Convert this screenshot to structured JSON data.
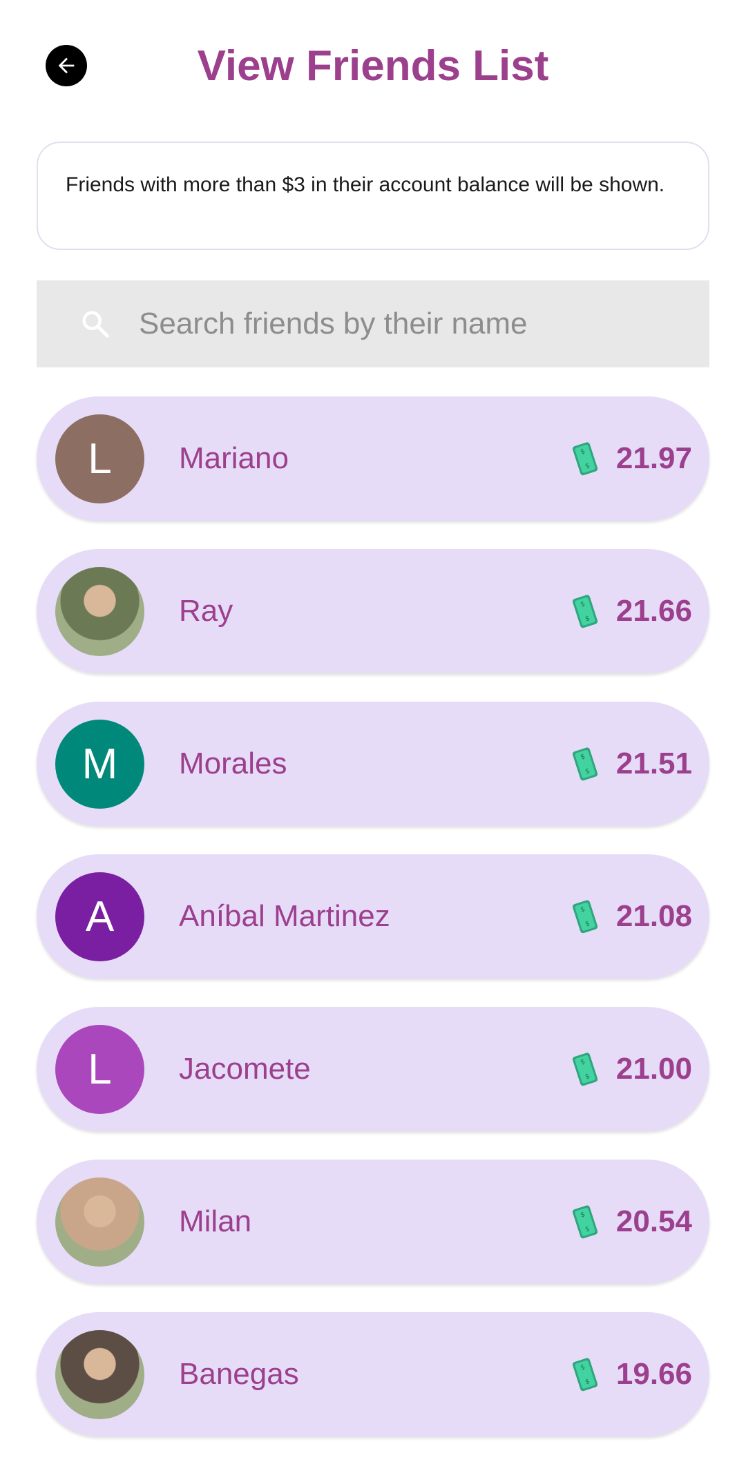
{
  "header": {
    "back_icon": "arrow-left-icon",
    "title": "View Friends List"
  },
  "notice": {
    "text": "Friends with more than $3 in their account balance will be shown."
  },
  "search": {
    "icon": "search-icon",
    "placeholder": "Search friends by their name",
    "value": ""
  },
  "colors": {
    "accent": "#9c3f8d",
    "row_background": "#e6dcf8",
    "search_background": "#e8e8e8",
    "money_green": "#3ec79a"
  },
  "friends": [
    {
      "name": "Mariano",
      "initial": "L",
      "avatar_type": "letter",
      "avatar_color": "#8d6e63",
      "balance": "21.97"
    },
    {
      "name": "Ray",
      "initial": "",
      "avatar_type": "photo",
      "avatar_color": "#6b7a55",
      "balance": "21.66"
    },
    {
      "name": "Morales",
      "initial": "M",
      "avatar_type": "letter",
      "avatar_color": "#00897b",
      "balance": "21.51"
    },
    {
      "name": "Aníbal Martinez",
      "initial": "A",
      "avatar_type": "letter",
      "avatar_color": "#7b1fa2",
      "balance": "21.08"
    },
    {
      "name": "Jacomete",
      "initial": "L",
      "avatar_type": "letter",
      "avatar_color": "#ab47bc",
      "balance": "21.00"
    },
    {
      "name": "Milan",
      "initial": "",
      "avatar_type": "photo",
      "avatar_color": "#c9a58a",
      "balance": "20.54"
    },
    {
      "name": "Banegas",
      "initial": "",
      "avatar_type": "photo",
      "avatar_color": "#5d4e45",
      "balance": "19.66"
    }
  ]
}
